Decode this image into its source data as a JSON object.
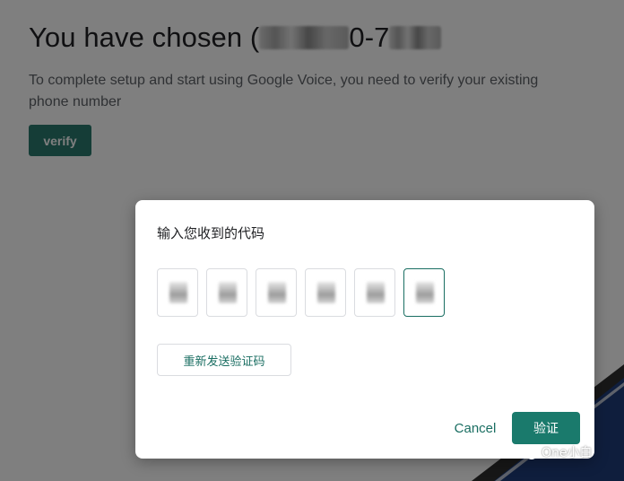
{
  "page": {
    "title_prefix": "You have chosen (",
    "title_visible_digits": "0-7",
    "description": "To complete setup and start using Google Voice, you need to verify your existing phone number",
    "verify_label": "verify"
  },
  "dialog": {
    "title": "输入您收到的代码",
    "code_boxes": [
      "",
      "",
      "",
      "",
      "",
      ""
    ],
    "resend_label": "重新发送验证码",
    "cancel_label": "Cancel",
    "confirm_label": "验证"
  },
  "watermark": {
    "text": "One小白"
  },
  "colors": {
    "accent": "#1a7a6c",
    "overlay": "rgba(0,0,0,0.5)",
    "title_text": "#202124",
    "secondary_text": "#5f6368"
  },
  "icons": {
    "watermark": "wechat-icon"
  }
}
